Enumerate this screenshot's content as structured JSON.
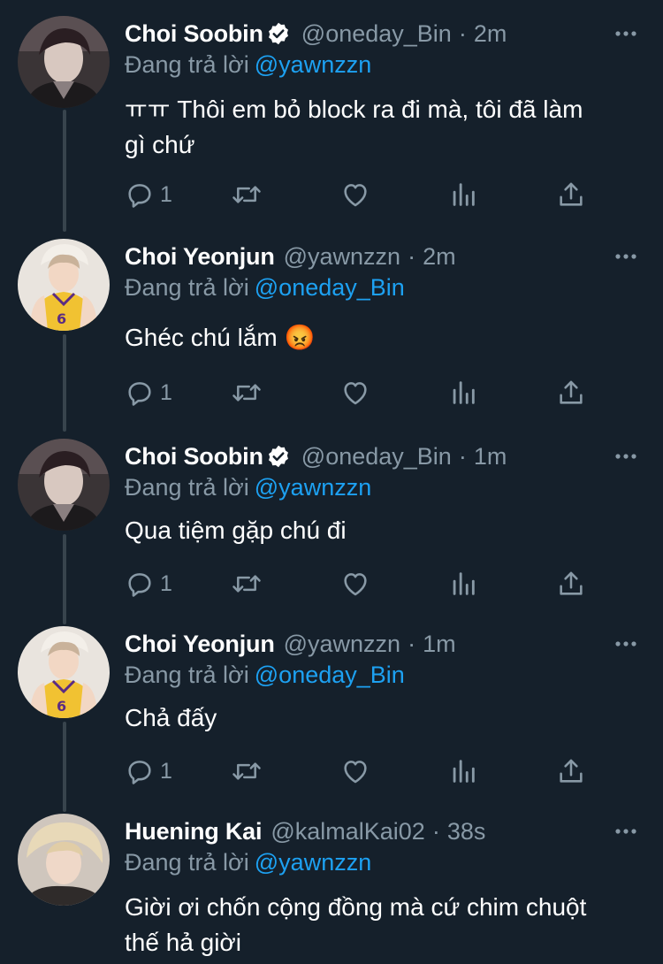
{
  "labels": {
    "replying_to": "Đang trả lời"
  },
  "colors": {
    "background": "#15202b",
    "text_primary": "#ffffff",
    "text_secondary": "#8899a6",
    "link": "#1da1f2",
    "thread_line": "#38444d",
    "verified": "#ffffff"
  },
  "tweets": [
    {
      "name": "Choi Soobin",
      "verified": true,
      "handle": "@oneday_Bin",
      "separator": "·",
      "time": "2m",
      "replying_to": "@yawnzzn",
      "text_line1": "ㅠㅠ Thôi em bỏ block ra đi mà, tôi đã làm",
      "text_line2": "gì chứ",
      "reply_count": "1",
      "avatar": "avatar-soobin"
    },
    {
      "name": "Choi Yeonjun",
      "verified": false,
      "handle": "@yawnzzn",
      "separator": "·",
      "time": "2m",
      "replying_to": "@oneday_Bin",
      "text_line1": "Ghéc chú lắm 😡",
      "text_line2": "",
      "reply_count": "1",
      "avatar": "avatar-yeonjun"
    },
    {
      "name": "Choi Soobin",
      "verified": true,
      "handle": "@oneday_Bin",
      "separator": "·",
      "time": "1m",
      "replying_to": "@yawnzzn",
      "text_line1": "Qua tiệm gặp chú đi",
      "text_line2": "",
      "reply_count": "1",
      "avatar": "avatar-soobin"
    },
    {
      "name": "Choi Yeonjun",
      "verified": false,
      "handle": "@yawnzzn",
      "separator": "·",
      "time": "1m",
      "replying_to": "@oneday_Bin",
      "text_line1": "Chả đấy",
      "text_line2": "",
      "reply_count": "1",
      "avatar": "avatar-yeonjun"
    },
    {
      "name": "Huening Kai",
      "verified": false,
      "handle": "@kalmalKai02",
      "separator": "·",
      "time": "38s",
      "replying_to": "@yawnzzn",
      "text_line1": "Giời ơi chốn cộng đồng mà cứ chim chuột",
      "text_line2": "thế hả giời",
      "reply_count": "",
      "avatar": "avatar-kai"
    }
  ],
  "icons": {
    "reply": "reply-icon",
    "retweet": "retweet-icon",
    "like": "heart-icon",
    "analytics": "analytics-icon",
    "share": "share-icon",
    "more": "more-icon",
    "verified": "verified-badge-icon"
  }
}
